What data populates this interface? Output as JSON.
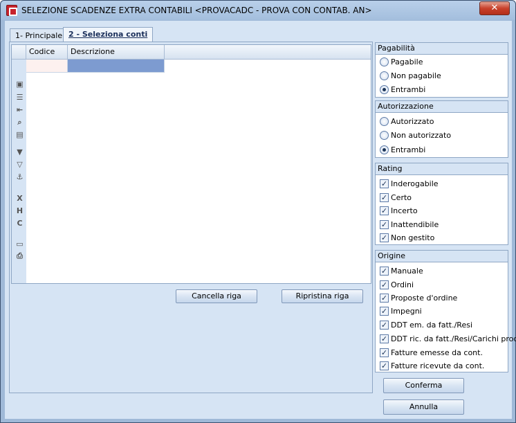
{
  "window": {
    "title": "SELEZIONE SCADENZE EXTRA CONTABILI <PROVACADC - PROVA CON CONTAB. AN>",
    "close_label": "✕"
  },
  "tabs": [
    {
      "label": "1- Principale",
      "active": false
    },
    {
      "label": "2 - Seleziona conti",
      "active": true
    }
  ],
  "grid": {
    "columns": [
      "Codice",
      "Descrizione"
    ]
  },
  "grid_tools": [
    "grid-toggle-icon",
    "list-icon",
    "import-icon",
    "search-icon",
    "keyboard-icon",
    "filter-icon",
    "filter-clear-icon",
    "anchor-icon",
    "export-excel-icon",
    "export-html-icon",
    "export-csv-icon",
    "monitor-icon",
    "print-icon"
  ],
  "buttons": {
    "cancella_riga": "Cancella riga",
    "ripristina_riga": "Ripristina riga",
    "conferma": "Conferma",
    "annulla": "Annulla"
  },
  "pagabilita": {
    "title": "Pagabilità",
    "options": [
      {
        "label": "Pagabile",
        "checked": false
      },
      {
        "label": "Non pagabile",
        "checked": false
      },
      {
        "label": "Entrambi",
        "checked": true
      }
    ]
  },
  "autorizzazione": {
    "title": "Autorizzazione",
    "options": [
      {
        "label": "Autorizzato",
        "checked": false
      },
      {
        "label": "Non autorizzato",
        "checked": false
      },
      {
        "label": "Entrambi",
        "checked": true
      }
    ]
  },
  "rating": {
    "title": "Rating",
    "options": [
      {
        "label": "Inderogabile",
        "checked": true
      },
      {
        "label": "Certo",
        "checked": true
      },
      {
        "label": "Incerto",
        "checked": true
      },
      {
        "label": "Inattendibile",
        "checked": true
      },
      {
        "label": "Non gestito",
        "checked": true
      }
    ]
  },
  "origine": {
    "title": "Origine",
    "options": [
      {
        "label": "Manuale",
        "checked": true
      },
      {
        "label": "Ordini",
        "checked": true
      },
      {
        "label": "Proposte d'ordine",
        "checked": true
      },
      {
        "label": "Impegni",
        "checked": true
      },
      {
        "label": "DDT em. da fatt./Resi",
        "checked": true
      },
      {
        "label": "DDT ric. da fatt./Resi/Carichi prod.",
        "checked": true
      },
      {
        "label": "Fatture emesse da cont.",
        "checked": true
      },
      {
        "label": "Fatture ricevute da cont.",
        "checked": true
      }
    ]
  }
}
